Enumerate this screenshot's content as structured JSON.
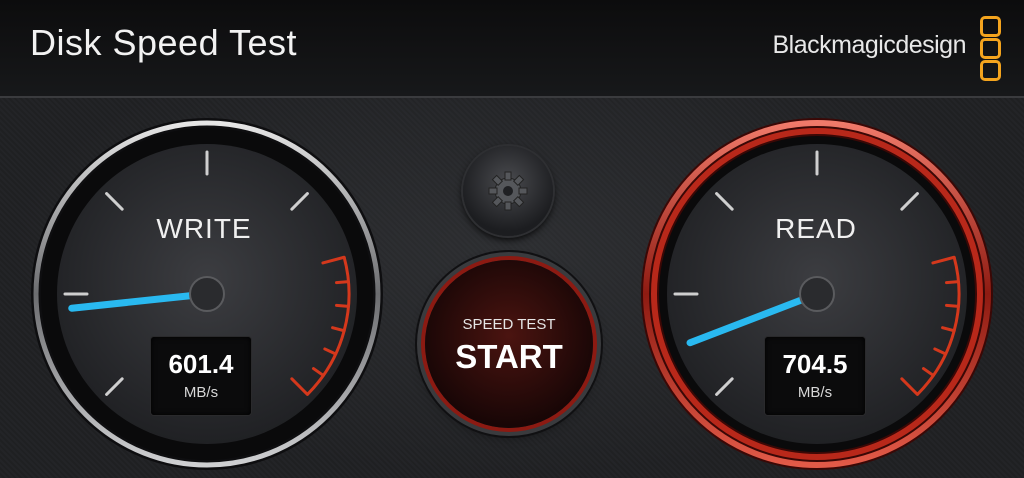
{
  "window": {
    "close_glyph": "×"
  },
  "header": {
    "title": "Disk Speed Test",
    "brand": "Blackmagicdesign"
  },
  "write_gauge": {
    "label": "WRITE",
    "value": "601.4",
    "unit": "MB/s",
    "needle_angle_deg": 186
  },
  "read_gauge": {
    "label": "READ",
    "value": "704.5",
    "unit": "MB/s",
    "needle_angle_deg": 201
  },
  "controls": {
    "start_sub_label": "SPEED TEST",
    "start_label": "START"
  },
  "colors": {
    "needle": "#29b9f0",
    "accent_red": "#d4381c",
    "logo_orange": "#f4a41e"
  }
}
